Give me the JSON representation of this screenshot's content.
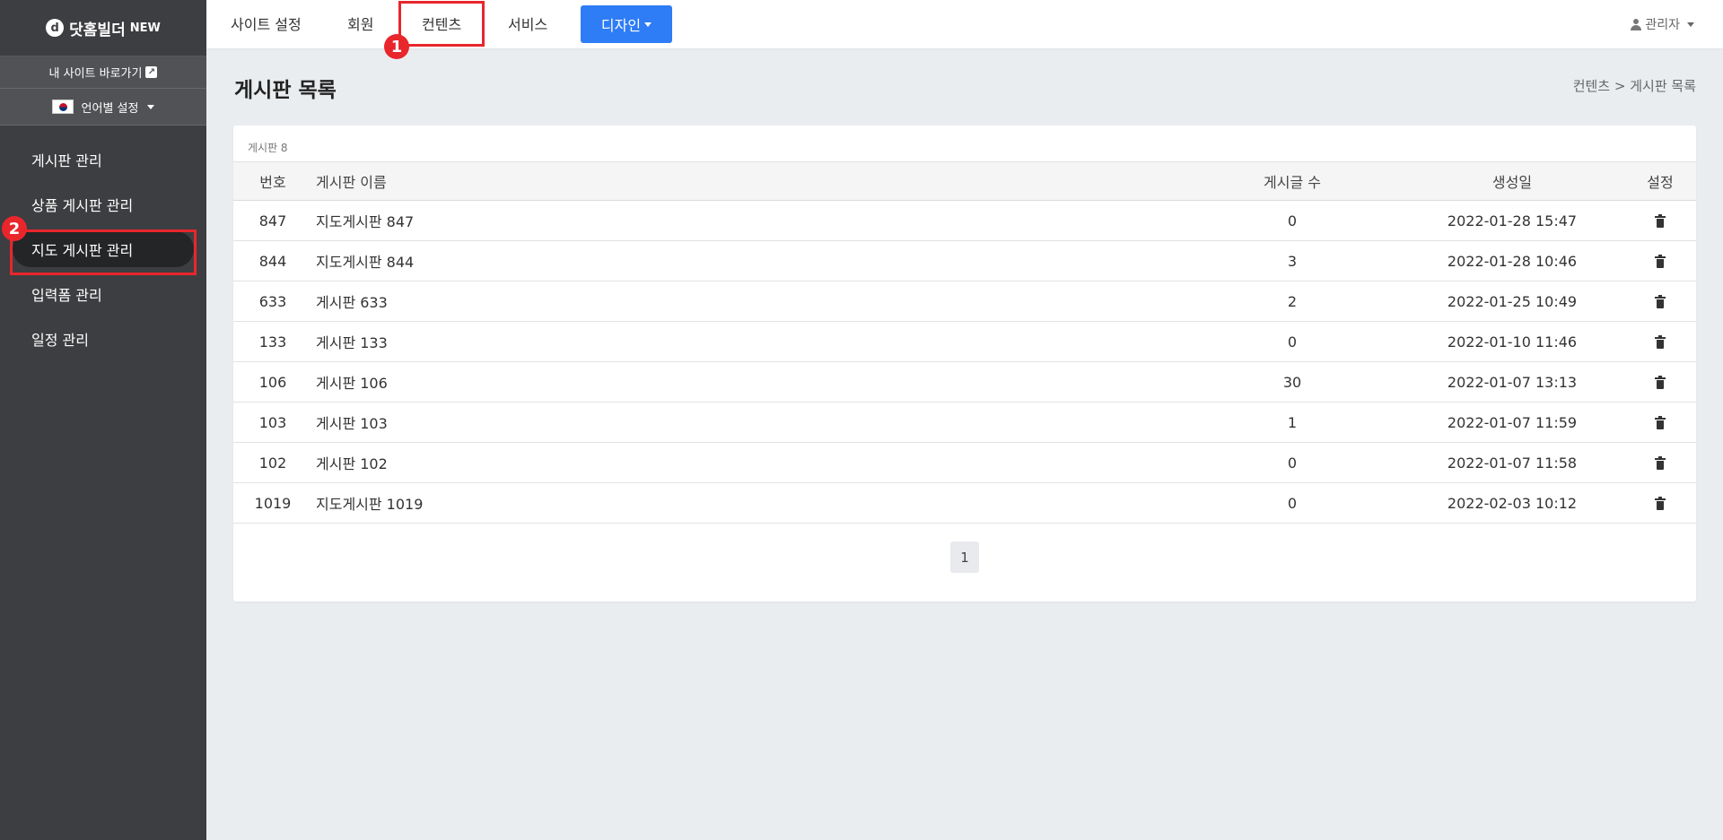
{
  "sidebar": {
    "logo_mark": "d",
    "logo_text": "닷홈빌더",
    "logo_new": "NEW",
    "site_link": "내 사이트 바로가기",
    "language": "언어별 설정",
    "items": [
      {
        "label": "게시판 관리"
      },
      {
        "label": "상품 게시판 관리"
      },
      {
        "label": "지도 게시판 관리"
      },
      {
        "label": "입력폼 관리"
      },
      {
        "label": "일정 관리"
      }
    ],
    "active_index": 2
  },
  "topnav": {
    "items": [
      "사이트 설정",
      "회원",
      "컨텐츠",
      "서비스"
    ],
    "design_button": "디자인",
    "admin": "관리자"
  },
  "annotations": {
    "badge1": "1",
    "badge2": "2",
    "color": "#e8262c"
  },
  "page": {
    "title": "게시판 목록",
    "breadcrumb": "컨텐츠 > 게시판 목록"
  },
  "board": {
    "count_label": "게시판 8",
    "columns": [
      "번호",
      "게시판 이름",
      "게시글 수",
      "생성일",
      "설정"
    ],
    "rows": [
      {
        "no": "847",
        "name": "지도게시판 847",
        "posts": "0",
        "date": "2022-01-28 15:47"
      },
      {
        "no": "844",
        "name": "지도게시판 844",
        "posts": "3",
        "date": "2022-01-28 10:46"
      },
      {
        "no": "633",
        "name": "게시판 633",
        "posts": "2",
        "date": "2022-01-25 10:49"
      },
      {
        "no": "133",
        "name": "게시판 133",
        "posts": "0",
        "date": "2022-01-10 11:46"
      },
      {
        "no": "106",
        "name": "게시판 106",
        "posts": "30",
        "date": "2022-01-07 13:13"
      },
      {
        "no": "103",
        "name": "게시판 103",
        "posts": "1",
        "date": "2022-01-07 11:59"
      },
      {
        "no": "102",
        "name": "게시판 102",
        "posts": "0",
        "date": "2022-01-07 11:58"
      },
      {
        "no": "1019",
        "name": "지도게시판 1019",
        "posts": "0",
        "date": "2022-02-03 10:12"
      }
    ],
    "page": "1"
  },
  "colors": {
    "accent": "#2e7cf6",
    "sidebar": "#3d3e41",
    "highlight": "#e8262c"
  }
}
